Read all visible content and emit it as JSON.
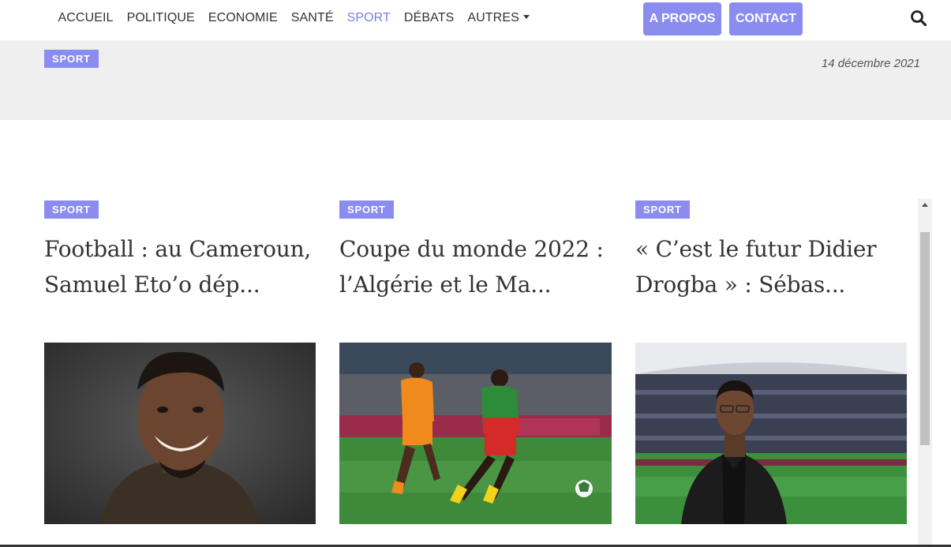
{
  "nav": {
    "links": [
      {
        "label": "ACCUEIL",
        "active": false
      },
      {
        "label": "POLITIQUE",
        "active": false
      },
      {
        "label": "ECONOMIE",
        "active": false
      },
      {
        "label": "SANTÉ",
        "active": false
      },
      {
        "label": "SPORT",
        "active": true
      },
      {
        "label": "DÉBATS",
        "active": false
      },
      {
        "label": "AUTRES",
        "active": false
      }
    ],
    "about_label": "A PROPOS",
    "contact_label": "CONTACT",
    "search_icon": "search-icon"
  },
  "hero": {
    "category": "SPORT",
    "date": "14 décembre 2021"
  },
  "articles": [
    {
      "category": "SPORT",
      "title": "Football : au Cameroun, Samuel Eto’o dép..."
    },
    {
      "category": "SPORT",
      "title": "Coupe du monde 2022 : l’Algérie et le Ma..."
    },
    {
      "category": "SPORT",
      "title": "« C’est le futur Didier Drogba » : Sébas..."
    }
  ],
  "colors": {
    "accent": "#8a8cf0",
    "active_link": "#7b7fe0",
    "hero_bg": "#efefef",
    "text": "#333333"
  }
}
